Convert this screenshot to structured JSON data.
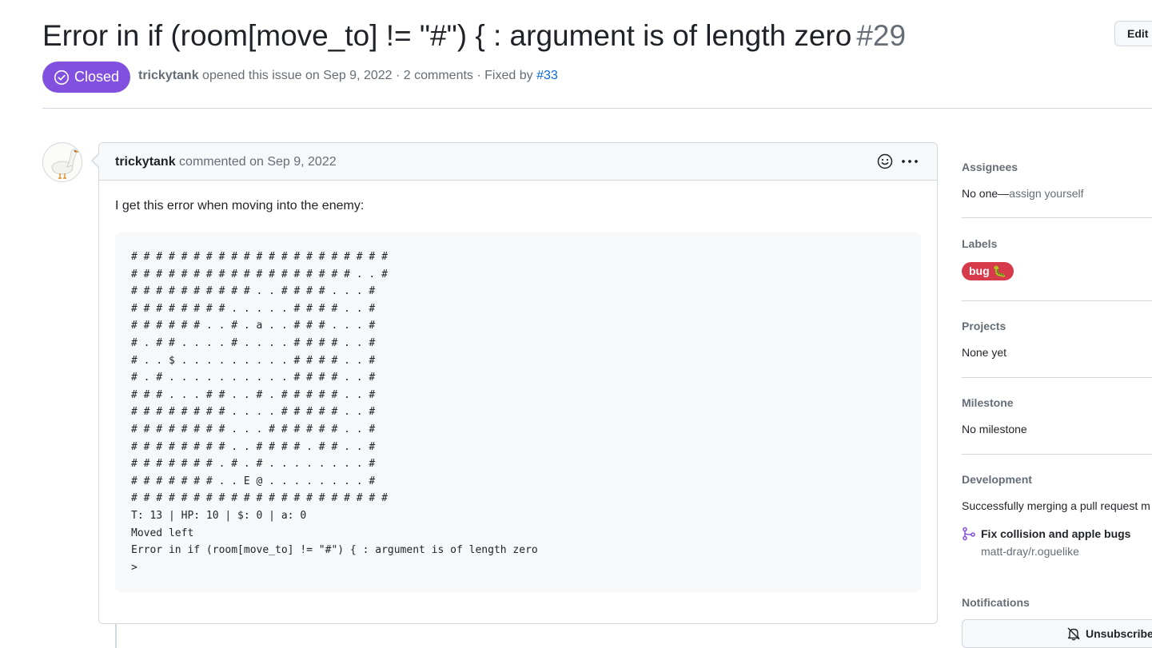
{
  "issue": {
    "title": "Error in if (room[move_to] != \"#\") { : argument is of length zero",
    "number": "#29",
    "edit_label": "Edit",
    "state": "Closed",
    "author": "trickytank",
    "opened_text": "opened this issue on Sep 9, 2022 · 2 comments · Fixed by",
    "fixed_by": "#33"
  },
  "comment": {
    "author": "trickytank",
    "timestamp": "commented on Sep 9, 2022",
    "body_text": "I get this error when moving into the enemy:",
    "code": "# # # # # # # # # # # # # # # # # # # # #\n# # # # # # # # # # # # # # # # # # . . #\n# # # # # # # # # # . . # # # # . . . #\n# # # # # # # # . . . . . # # # # . . #\n# # # # # # . . # . a . . # # # . . . #\n# . # # . . . . # . . . . # # # # . . #\n# . . $ . . . . . . . . . # # # # . . #\n# . # . . . . . . . . . . # # # # . . #\n# # # . . . # # . . # . # # # # # . . #\n# # # # # # # # . . . . # # # # # . . #\n# # # # # # # # . . . # # # # # # . . #\n# # # # # # # # . . # # # # . # # . . #\n# # # # # # # . # . # . . . . . . . . #\n# # # # # # # . . E @ . . . . . . . . #\n# # # # # # # # # # # # # # # # # # # # #\nT: 13 | HP: 10 | $: 0 | a: 0\nMoved left\nError in if (room[move_to] != \"#\") { : argument is of length zero\n>"
  },
  "sidebar": {
    "assignees": {
      "heading": "Assignees",
      "value": "No one—",
      "action": "assign yourself"
    },
    "labels": {
      "heading": "Labels",
      "items": [
        {
          "name": "bug 🐛",
          "color": "#d73a4a"
        }
      ]
    },
    "projects": {
      "heading": "Projects",
      "value": "None yet"
    },
    "milestone": {
      "heading": "Milestone",
      "value": "No milestone"
    },
    "development": {
      "heading": "Development",
      "text": "Successfully merging a pull request m",
      "pr_title": "Fix collision and apple bugs",
      "pr_repo": "matt-dray/r.oguelike"
    },
    "notifications": {
      "heading": "Notifications",
      "button": "Unsubscribe"
    }
  },
  "colors": {
    "closed": "#8250df",
    "link": "#0969da",
    "border": "#d0d7de",
    "muted": "#656d76"
  },
  "icons": [
    "check-circle-icon",
    "smiley-icon",
    "kebab-horizontal-icon",
    "git-pull-request-icon",
    "bell-slash-icon"
  ]
}
